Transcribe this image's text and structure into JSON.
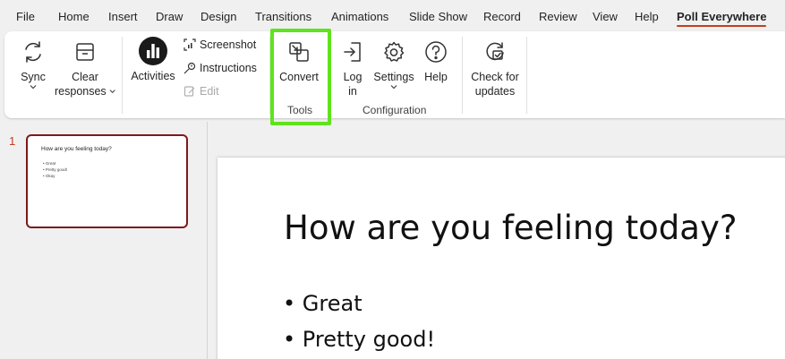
{
  "tabs": [
    "File",
    "Home",
    "Insert",
    "Draw",
    "Design",
    "Transitions",
    "Animations",
    "Slide Show",
    "Record",
    "Review",
    "View",
    "Help",
    "Poll Everywhere"
  ],
  "active_tab": "Poll Everywhere",
  "ribbon": {
    "sync": "Sync",
    "clear_line1": "Clear",
    "clear_line2": "responses",
    "activities": "Activities",
    "screenshot": "Screenshot",
    "instructions": "Instructions",
    "edit": "Edit",
    "convert": "Convert",
    "tools_label": "Tools",
    "login_line1": "Log",
    "login_line2": "in",
    "settings": "Settings",
    "help": "Help",
    "configuration_label": "Configuration",
    "check_line1": "Check for",
    "check_line2": "updates"
  },
  "slides": [
    {
      "number": "1",
      "title": "How are you feeling today?",
      "bullets": [
        "Great",
        "Pretty good!",
        "Okay"
      ]
    }
  ],
  "main_slide": {
    "title": "How are you feeling today?",
    "bullets": [
      "Great",
      "Pretty good!"
    ]
  },
  "colors": {
    "accent": "#c43e1c",
    "highlight": "#5ee41c",
    "thumb_border": "#7d1a1a"
  }
}
